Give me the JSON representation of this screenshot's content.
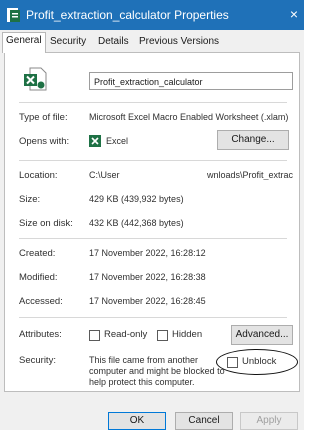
{
  "window": {
    "title": "Profit_extraction_calculator Properties",
    "close_glyph": "×",
    "icon": "properties-icon"
  },
  "tabs": [
    {
      "label": "General",
      "active": true
    },
    {
      "label": "Security",
      "active": false
    },
    {
      "label": "Details",
      "active": false
    },
    {
      "label": "Previous Versions",
      "active": false
    }
  ],
  "general": {
    "file_icon": "excel-file-icon",
    "file_name": "Profit_extraction_calculator",
    "type_label": "Type of file:",
    "type_value": "Microsoft Excel Macro Enabled Worksheet (.xlam)",
    "opens_label": "Opens with:",
    "opens_app": "Excel",
    "change_button": "Change...",
    "location_label": "Location:",
    "location_prefix": "C:\\User",
    "location_suffix": "wnloads\\Profit_extrac",
    "size_label": "Size:",
    "size_value": "429 KB (439,932 bytes)",
    "size_disk_label": "Size on disk:",
    "size_disk_value": "432 KB (442,368 bytes)",
    "created_label": "Created:",
    "created_value": "17 November 2022, 16:28:12",
    "modified_label": "Modified:",
    "modified_value": "17 November 2022, 16:28:38",
    "accessed_label": "Accessed:",
    "accessed_value": "17 November 2022, 16:28:45",
    "attributes_label": "Attributes:",
    "readonly_label": "Read-only",
    "hidden_label": "Hidden",
    "advanced_button": "Advanced...",
    "security_label": "Security:",
    "security_line1": "This file came from another",
    "security_line2": "computer and might be blocked to",
    "security_line3": "help protect this computer.",
    "unblock_label": "Unblock"
  },
  "footer": {
    "ok": "OK",
    "cancel": "Cancel",
    "apply": "Apply"
  },
  "colors": {
    "titlebar": "#1f71b8",
    "excel_green": "#1e7145"
  }
}
